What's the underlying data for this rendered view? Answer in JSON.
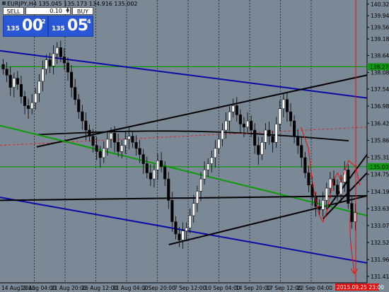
{
  "window": {
    "title": "EURJPY,H4  135.045 135.173 134.916 135.002"
  },
  "trade_panel": {
    "sell_label": "SELL",
    "buy_label": "BUY",
    "lot_value": "0.10",
    "bid": {
      "small": "135",
      "big": "00",
      "sup": "2"
    },
    "ask": {
      "small": "135",
      "big": "05",
      "sup": "4"
    }
  },
  "colors": {
    "background": "#7b8895",
    "grid": "#000000",
    "candle_up": "#000000",
    "candle_down": "#000000",
    "trend_blue": "#0a0aa8",
    "trend_black": "#000000",
    "trend_green": "#0d9a0d",
    "horizontal_green": "#0d9a0d",
    "vertical_red": "#e01010",
    "ma_black": "#000000",
    "dotted_red": "#d22020",
    "dt_tag_bg": "#e01010"
  },
  "chart_data": {
    "type": "candlestick",
    "symbol": "EURJPY",
    "timeframe": "H4",
    "ohlc_header": {
      "open": 135.045,
      "high": 135.173,
      "low": 134.916,
      "close": 135.002
    },
    "ylim": [
      131.2,
      140.46
    ],
    "price_ticks": [
      "140.325",
      "139.945",
      "139.565",
      "139.185",
      "138.645",
      "138.085",
      "137.545",
      "136.985",
      "136.425",
      "135.865",
      "135.310",
      "134.750",
      "134.190",
      "133.630",
      "133.075",
      "132.520",
      "131.960",
      "131.410"
    ],
    "price_tick_values": [
      140.325,
      139.945,
      139.565,
      139.185,
      138.645,
      138.085,
      137.545,
      136.985,
      136.425,
      135.865,
      135.31,
      134.75,
      134.19,
      133.63,
      133.075,
      132.52,
      131.96,
      131.41
    ],
    "price_tags": [
      {
        "label": "138.276",
        "value": 138.276,
        "color": "#0d9a0d"
      },
      {
        "label": "135.002",
        "value": 135.002,
        "color": "#0d9a0d"
      }
    ],
    "x_tick_labels": [
      "14 Aug 2015",
      "19 Aug 04:00",
      "21 Aug 20:00",
      "26 Aug 12:00",
      "31 Aug 04:00",
      "2 Sep 20:00",
      "7 Sep 12:00",
      "10 Sep 04:00",
      "14 Sep 20:00",
      "17 Sep 12:00",
      "22 Sep 04:00"
    ],
    "current_time_label": "2015.09.25 23:00",
    "closes": [
      138.2,
      138.0,
      137.6,
      137.9,
      137.7,
      137.3,
      137.0,
      136.9,
      137.1,
      137.4,
      137.8,
      138.2,
      138.5,
      138.3,
      138.7,
      138.9,
      138.6,
      138.4,
      138.1,
      137.6,
      137.2,
      136.8,
      136.5,
      136.2,
      136.0,
      135.7,
      135.5,
      135.3,
      135.6,
      135.9,
      136.1,
      135.8,
      135.5,
      135.7,
      135.9,
      136.0,
      135.8,
      135.6,
      135.4,
      135.1,
      134.8,
      134.6,
      134.9,
      135.2,
      135.0,
      134.6,
      133.9,
      133.2,
      132.8,
      132.6,
      132.9,
      133.0,
      133.4,
      133.8,
      134.2,
      134.6,
      134.9,
      135.1,
      135.3,
      135.6,
      135.9,
      136.2,
      136.5,
      136.8,
      137.0,
      136.7,
      136.4,
      136.3,
      136.5,
      136.2,
      135.7,
      135.4,
      135.8,
      136.2,
      136.0,
      135.8,
      136.4,
      136.9,
      137.2,
      136.8,
      136.5,
      136.0,
      135.7,
      135.3,
      134.8,
      134.4,
      134.0,
      133.7,
      133.6,
      133.9,
      134.3,
      134.6,
      134.4,
      134.1,
      134.5,
      134.9,
      133.8,
      133.2,
      133.5
    ],
    "lines": [
      {
        "name": "blue-channel-top",
        "color": "#0a0aa8",
        "p1": [
          0,
          138.8
        ],
        "p2": [
          100,
          137.25
        ]
      },
      {
        "name": "blue-channel-bottom",
        "color": "#0a0aa8",
        "p1": [
          0,
          134.0
        ],
        "p2": [
          100,
          131.85
        ]
      },
      {
        "name": "black-trend-upper",
        "color": "#000000",
        "p1": [
          10,
          135.65
        ],
        "p2": [
          100,
          138.0
        ]
      },
      {
        "name": "black-trend-lower",
        "color": "#000000",
        "p1": [
          46,
          132.45
        ],
        "p2": [
          100,
          134.05
        ]
      },
      {
        "name": "green-trend",
        "color": "#0d9a0d",
        "p1": [
          0,
          136.35
        ],
        "p2": [
          100,
          133.4
        ]
      },
      {
        "name": "black-flat",
        "color": "#000000",
        "p1": [
          0,
          133.9
        ],
        "p2": [
          100,
          134.05
        ]
      },
      {
        "name": "wedge-top",
        "color": "#000000",
        "p1": [
          89,
          133.6
        ],
        "p2": [
          100,
          135.4
        ]
      },
      {
        "name": "wedge-bottom",
        "color": "#000000",
        "p1": [
          88,
          133.3
        ],
        "p2": [
          100,
          134.8
        ]
      }
    ],
    "horizontal_levels": [
      138.276,
      135.002
    ],
    "moving_average": {
      "color": "#000000",
      "start": 136.05,
      "mid": 136.2,
      "end": 135.85
    }
  }
}
